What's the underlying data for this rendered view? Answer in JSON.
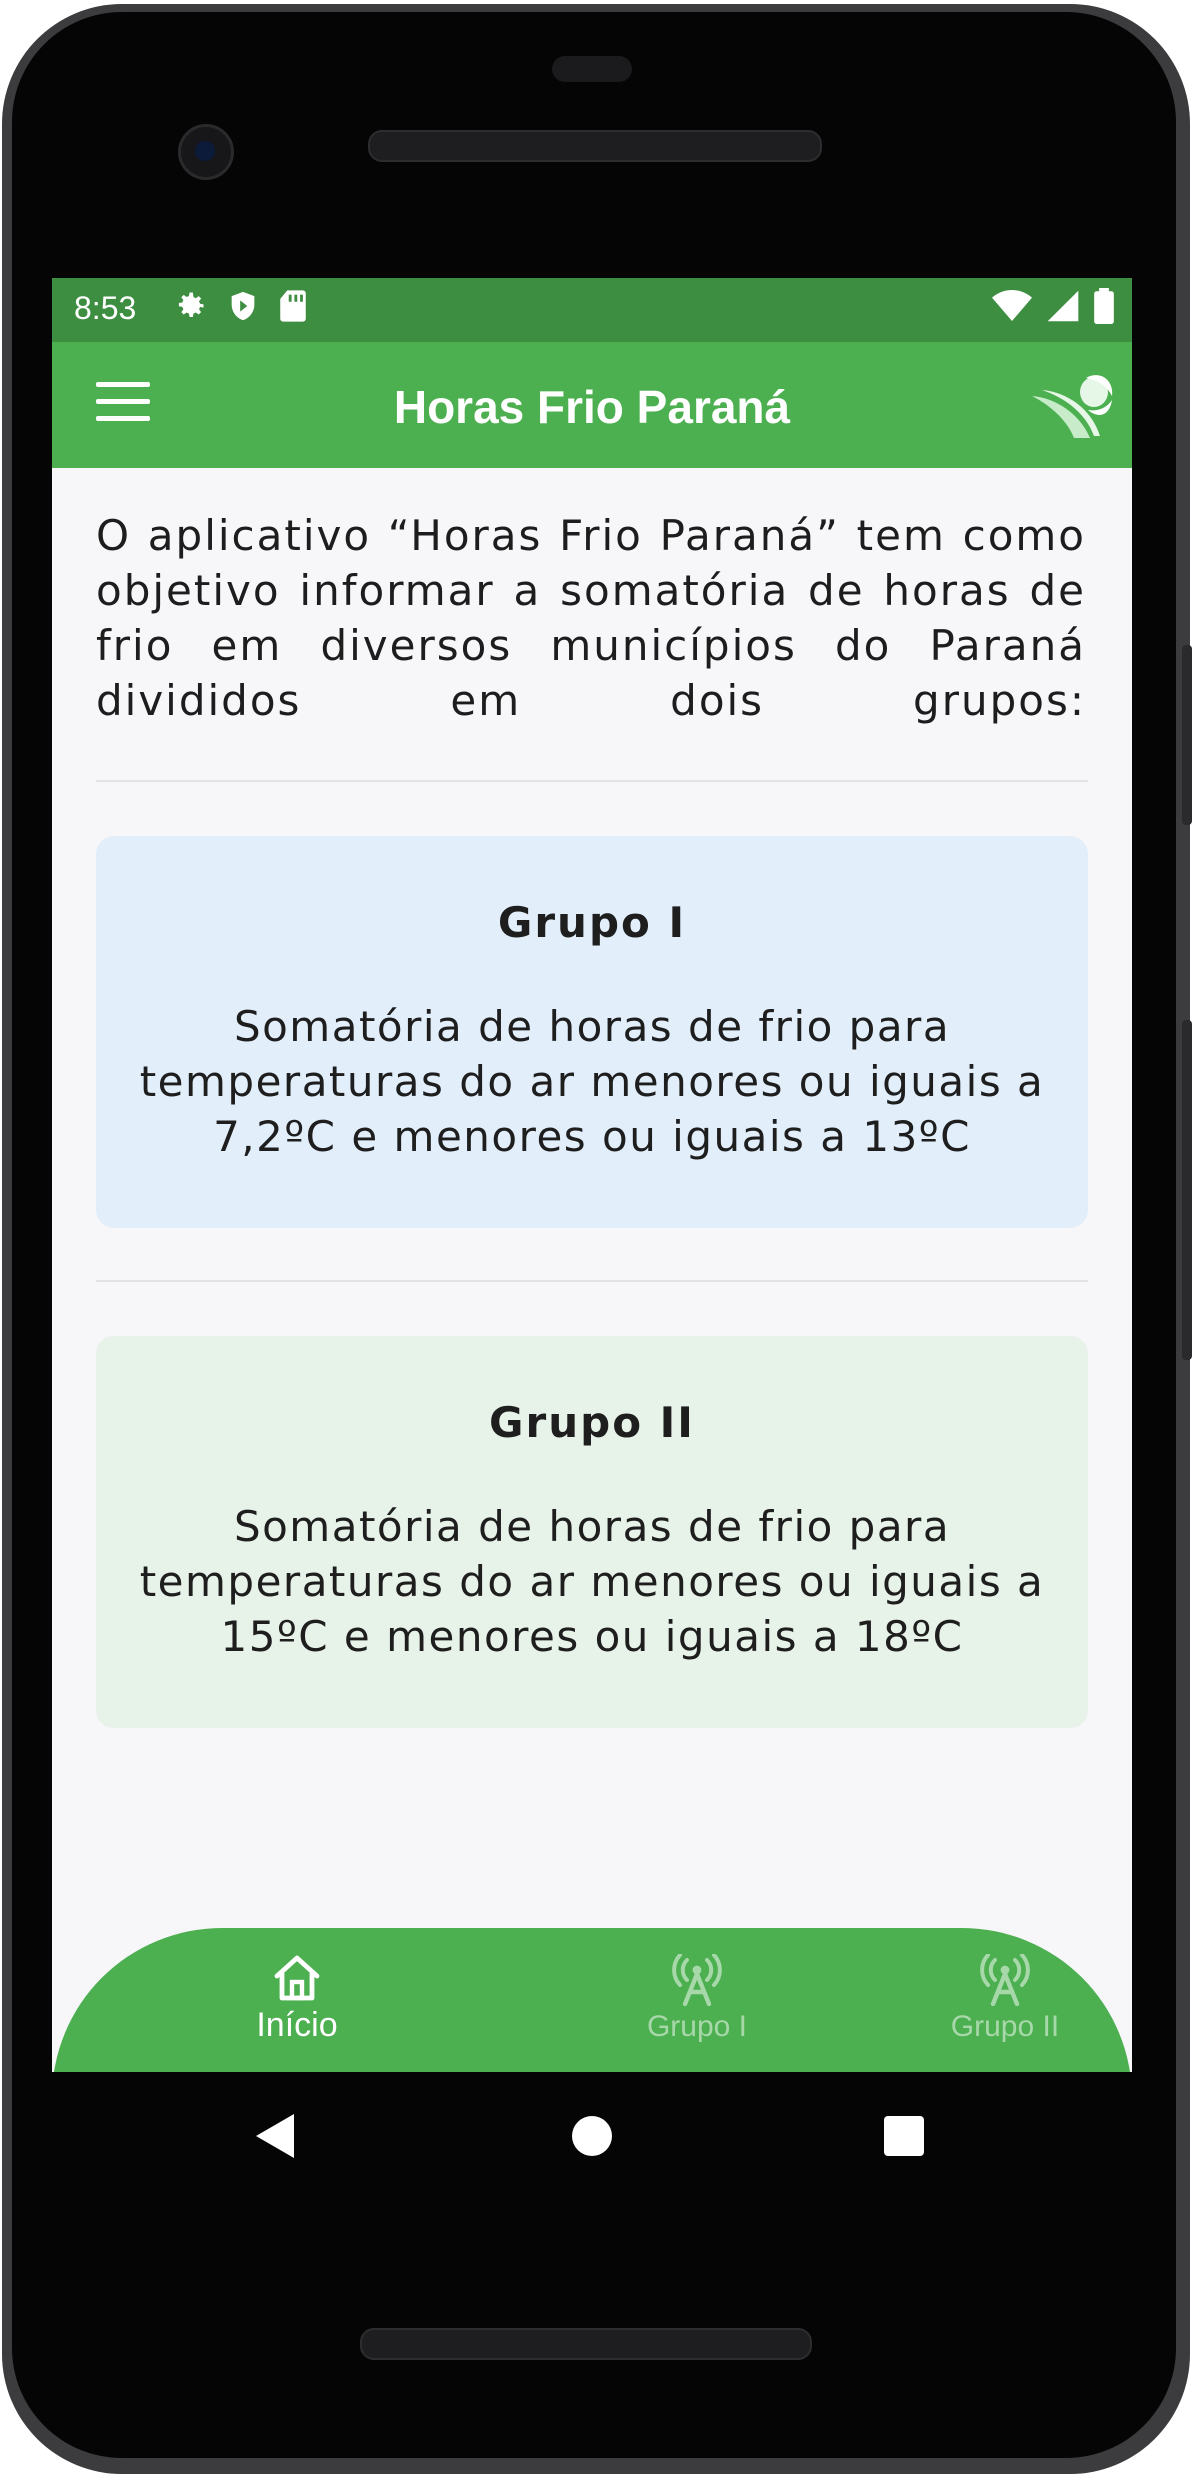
{
  "status_bar": {
    "time": "8:53",
    "left_icons": [
      "gear-icon",
      "shield-icon",
      "sd-card-icon"
    ],
    "right_icons": [
      "wifi-icon",
      "signal-icon",
      "battery-icon"
    ]
  },
  "app_bar": {
    "title": "Horas Frio Paraná",
    "menu_icon": "menu-icon",
    "logo_icon": "app-logo-icon"
  },
  "intro_text": "O aplicativo “Horas Frio Paraná” tem como objetivo informar a somatória de horas de frio em diversos municípios do Paraná divididos em dois grupos:",
  "groups": [
    {
      "title": "Grupo I",
      "description": "Somatória de horas de frio para temperaturas do ar menores ou iguais a 7,2ºC e menores ou iguais a 13ºC",
      "background": "#e2effb"
    },
    {
      "title": "Grupo II",
      "description": "Somatória de horas de frio para temperaturas do ar menores ou iguais a 15ºC e menores ou iguais a 18ºC",
      "background": "#e7f3e8"
    }
  ],
  "bottom_nav": {
    "items": [
      {
        "label": "Início",
        "icon": "home-icon",
        "active": true
      },
      {
        "label": "Grupo I",
        "icon": "antenna-icon",
        "active": false
      },
      {
        "label": "Grupo II",
        "icon": "antenna-icon",
        "active": false
      }
    ]
  },
  "colors": {
    "primary": "#4caf50",
    "status_bar": "#3e8e41",
    "inactive_nav": "#a7d8a9"
  },
  "system_nav": [
    "back-icon",
    "home-circle-icon",
    "recent-apps-icon"
  ]
}
